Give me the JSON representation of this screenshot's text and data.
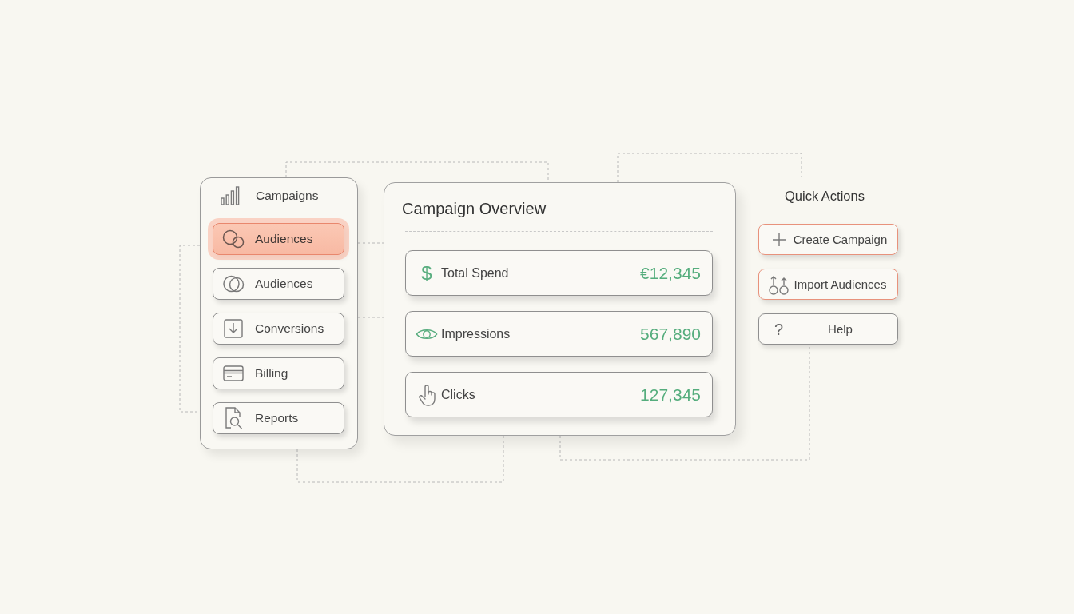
{
  "sidebar": {
    "title": "Campaigns",
    "items": [
      {
        "label": "Audiences",
        "selected": true
      },
      {
        "label": "Audiences",
        "selected": false
      },
      {
        "label": "Conversions",
        "selected": false
      },
      {
        "label": "Billing",
        "selected": false
      },
      {
        "label": "Reports",
        "selected": false
      }
    ]
  },
  "overview": {
    "title": "Campaign Overview",
    "metrics": [
      {
        "symbol": "$",
        "label": "Total Spend",
        "value": "€12,345"
      },
      {
        "label": "Impressions",
        "value": "567,890"
      },
      {
        "label": "Clicks",
        "value": "127,345"
      }
    ]
  },
  "quick_actions": {
    "title": "Quick Actions",
    "buttons": [
      {
        "label": "Create Campaign",
        "emphasized": true
      },
      {
        "label": "Import Audiences",
        "emphasized": true
      },
      {
        "symbol": "?",
        "label": "Help",
        "emphasized": false
      }
    ]
  }
}
